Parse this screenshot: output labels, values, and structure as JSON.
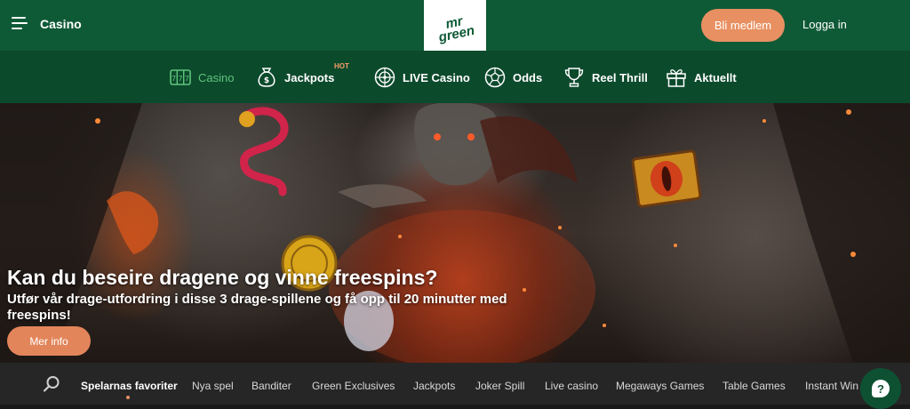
{
  "header": {
    "section_label": "Casino",
    "logo_text_line1": "mr",
    "logo_text_line2": "green",
    "signup_label": "Bli medlem",
    "login_label": "Logga in"
  },
  "nav": {
    "items": [
      {
        "label": "Casino",
        "icon": "slot-machine-icon"
      },
      {
        "label": "Jackpots",
        "icon": "money-bag-icon",
        "badge": "HOT"
      },
      {
        "label": "LIVE Casino",
        "icon": "roulette-icon"
      },
      {
        "label": "Odds",
        "icon": "football-icon"
      },
      {
        "label": "Reel Thrill",
        "icon": "trophy-icon"
      },
      {
        "label": "Aktuellt",
        "icon": "gift-icon"
      }
    ],
    "active_color": "#5fc47b"
  },
  "hero": {
    "title": "Kan du beseire dragene og vinne freespins?",
    "subtitle": "Utfør vår drage-utfordring i disse 3 drage-spillene og få opp til 20 minutter med freespins!",
    "cta_label": "Mer info"
  },
  "categories": {
    "items": [
      "Spelarnas favoriter",
      "Nya spel",
      "Banditer",
      "Green Exclusives",
      "Jackpots",
      "Joker Spill",
      "Live casino",
      "Megaways Games",
      "Table Games",
      "Instant Win"
    ],
    "active_index": 0
  },
  "help": {
    "glyph": "?"
  },
  "colors": {
    "brand_green": "#0f5a36",
    "nav_green": "#0c4a2c",
    "accent_orange": "#e89062"
  }
}
